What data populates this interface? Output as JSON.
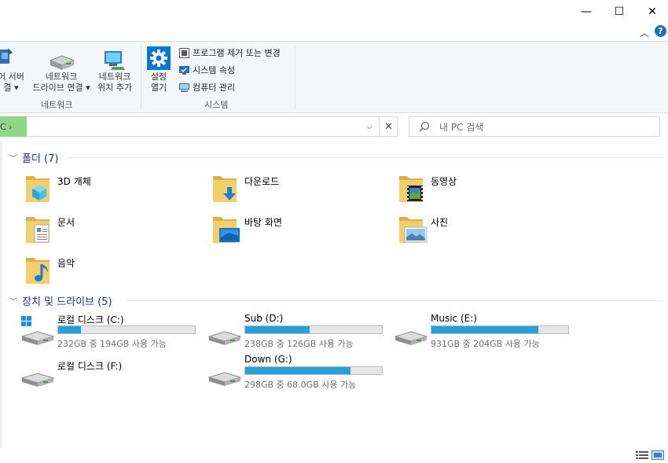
{
  "window": {
    "minimize": "—",
    "maximize": "☐",
    "close": "✕",
    "help": "?"
  },
  "ribbon": {
    "network": {
      "items": [
        {
          "line1": "어 서버",
          "line2": "결 ▾"
        },
        {
          "line1": "네트워크",
          "line2": "드라이브 연결 ▾"
        },
        {
          "line1": "네트워크",
          "line2": "위치 추가"
        }
      ],
      "group_label": "네트워크"
    },
    "system": {
      "settings": {
        "line1": "설정",
        "line2": "열기"
      },
      "small_items": [
        "프로그램 제거 또는 변경",
        "시스템 속성",
        "컴퓨터 관리"
      ],
      "group_label": "시스템"
    }
  },
  "address": {
    "crumb": "C ›",
    "dropdown": "⌵",
    "clear": "✕"
  },
  "search": {
    "placeholder": "내 PC 검색"
  },
  "folders": {
    "header": "폴더 (7)",
    "items": [
      {
        "name": "3D 개체",
        "icon": "3d-objects-folder-icon"
      },
      {
        "name": "다운로드",
        "icon": "downloads-folder-icon"
      },
      {
        "name": "동영상",
        "icon": "videos-folder-icon"
      },
      {
        "name": "문서",
        "icon": "documents-folder-icon"
      },
      {
        "name": "바탕 화면",
        "icon": "desktop-folder-icon"
      },
      {
        "name": "사진",
        "icon": "pictures-folder-icon"
      },
      {
        "name": "음악",
        "icon": "music-folder-icon"
      }
    ]
  },
  "drives": {
    "header": "장치 및 드라이브 (5)",
    "items": [
      {
        "name": "로컬 디스크 (C:)",
        "free": "232GB 중 194GB 사용 가능",
        "used_fraction": 0.164,
        "system": true,
        "bar": true
      },
      {
        "name": "Sub (D:)",
        "free": "238GB 중 126GB 사용 가능",
        "used_fraction": 0.471,
        "system": false,
        "bar": true
      },
      {
        "name": "Music (E:)",
        "free": "931GB 중 204GB 사용 가능",
        "used_fraction": 0.781,
        "system": false,
        "bar": true
      },
      {
        "name": "로컬 디스크 (F:)",
        "free": "",
        "used_fraction": 0,
        "system": false,
        "bar": false
      },
      {
        "name": "Down (G:)",
        "free": "298GB 중 68.0GB 사용 가능",
        "used_fraction": 0.772,
        "system": false,
        "bar": true
      }
    ]
  },
  "colors": {
    "accent": "#1e3287",
    "bar_fill": "#26a0da",
    "folder": "#f0c75e"
  }
}
